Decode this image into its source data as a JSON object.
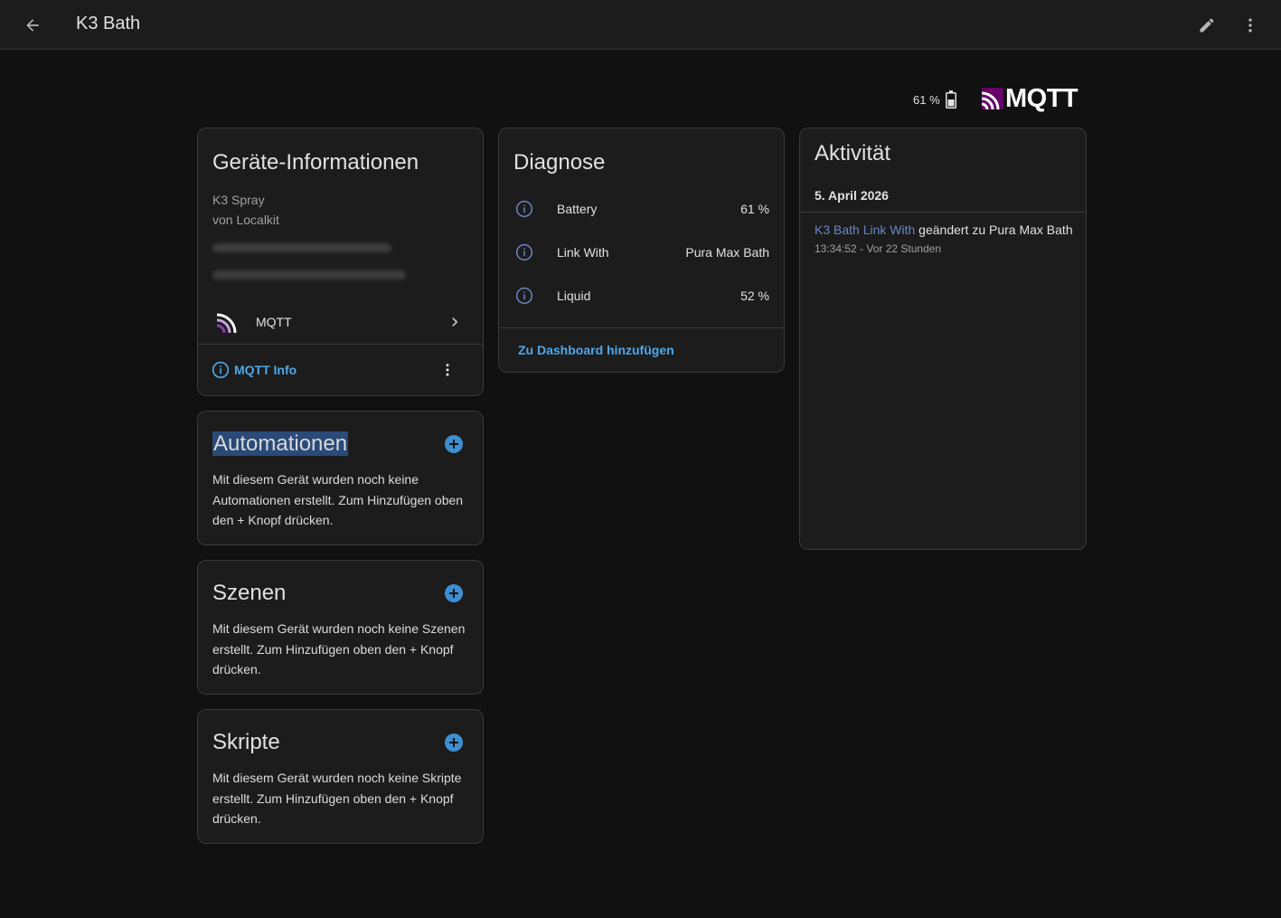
{
  "topbar": {
    "title": "K3 Bath",
    "back_icon": "arrow-left-icon",
    "edit_icon": "pencil-icon",
    "more_icon": "dots-vertical-icon"
  },
  "header": {
    "battery": "61 %",
    "battery_icon": "battery-icon",
    "brand": "MQTT",
    "battery_level": 0.61
  },
  "device_info": {
    "title": "Geräte-Informationen",
    "model": "K3 Spray",
    "manufacturer": "von Localkit",
    "integration": "MQTT",
    "info_link": "MQTT Info"
  },
  "automations": {
    "title": "Automationen",
    "description": "Mit diesem Gerät wurden noch keine Automationen erstellt. Zum Hinzufügen oben den + Knopf drücken."
  },
  "scenes": {
    "title": "Szenen",
    "description": "Mit diesem Gerät wurden noch keine Szenen erstellt. Zum Hinzufügen oben den + Knopf drücken."
  },
  "scripts": {
    "title": "Skripte",
    "description": "Mit diesem Gerät wurden noch keine Skripte erstellt. Zum Hinzufügen oben den + Knopf drücken."
  },
  "diagnose": {
    "title": "Diagnose",
    "rows": [
      {
        "label": "Battery",
        "value": "61 %"
      },
      {
        "label": "Link With",
        "value": "Pura Max Bath"
      },
      {
        "label": "Liquid",
        "value": "52 %"
      }
    ],
    "dashboard_link": "Zu Dashboard hinzufügen"
  },
  "activity": {
    "title": "Aktivität",
    "date": "5. April 2026",
    "entity": "K3 Bath Link With",
    "change": " geändert zu Pura Max Bath",
    "time": "13:34:52 - Vor 22 Stunden"
  },
  "colors": {
    "accent": "#4fa7e8",
    "entity_link": "#6b86c4",
    "mqtt_purple": "#660066"
  }
}
